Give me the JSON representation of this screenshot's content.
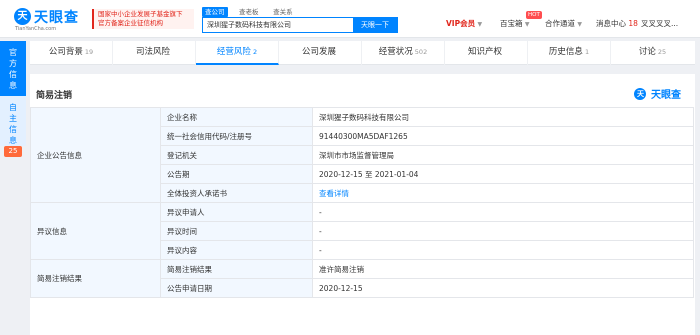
{
  "header": {
    "logo_badge": "天",
    "logo_text": "天眼查",
    "logo_sub": "TianYanCha.com",
    "promo_lines": [
      "国家中小企业发展子基金旗下",
      "官方备案企业征信机构"
    ],
    "search_tabs": [
      "查公司",
      "查老板",
      "查关系"
    ],
    "search_value": "深圳猩子数码科技有限公司",
    "search_button": "天眼一下",
    "vip": "VIP会员",
    "baibaoxiang": "百宝箱",
    "hot": "HOT",
    "cooperation": "合作通道",
    "messages": "消息中心",
    "message_count": "18",
    "user": "叉叉叉叉..."
  },
  "left_tabs": {
    "active": "官方信息",
    "inactive": "自主信息",
    "count": "25"
  },
  "categories": [
    {
      "label": "公司背景",
      "count": "19"
    },
    {
      "label": "司法风险",
      "count": ""
    },
    {
      "label": "经营风险",
      "count": "2"
    },
    {
      "label": "公司发展",
      "count": ""
    },
    {
      "label": "经营状况",
      "count": "502"
    },
    {
      "label": "知识产权",
      "count": ""
    },
    {
      "label": "历史信息",
      "count": "1"
    },
    {
      "label": "讨论",
      "count": "25"
    }
  ],
  "panel": {
    "title": "简易注销",
    "watermark_badge": "天",
    "watermark_text": "天眼查"
  },
  "table": {
    "groups": [
      {
        "name": "企业公告信息",
        "rows": [
          {
            "label": "企业名称",
            "value": "深圳猩子数码科技有限公司"
          },
          {
            "label": "统一社会信用代码/注册号",
            "value": "91440300MA5DAF1265"
          },
          {
            "label": "登记机关",
            "value": "深圳市市场监督管理局"
          },
          {
            "label": "公告期",
            "value": "2020-12-15 至 2021-01-04"
          },
          {
            "label": "全体投资人承诺书",
            "value": "查看详情"
          }
        ]
      },
      {
        "name": "异议信息",
        "rows": [
          {
            "label": "异议申请人",
            "value": "-"
          },
          {
            "label": "异议时间",
            "value": "-"
          },
          {
            "label": "异议内容",
            "value": "-"
          }
        ]
      },
      {
        "name": "简易注销结果",
        "rows": [
          {
            "label": "简易注销结果",
            "value": "准许简易注销"
          },
          {
            "label": "公告申请日期",
            "value": "2020-12-15"
          }
        ]
      }
    ]
  },
  "colors": {
    "brand": "#0084ff",
    "accent_red": "#e1251b",
    "label_bg": "#f2f8ff"
  }
}
